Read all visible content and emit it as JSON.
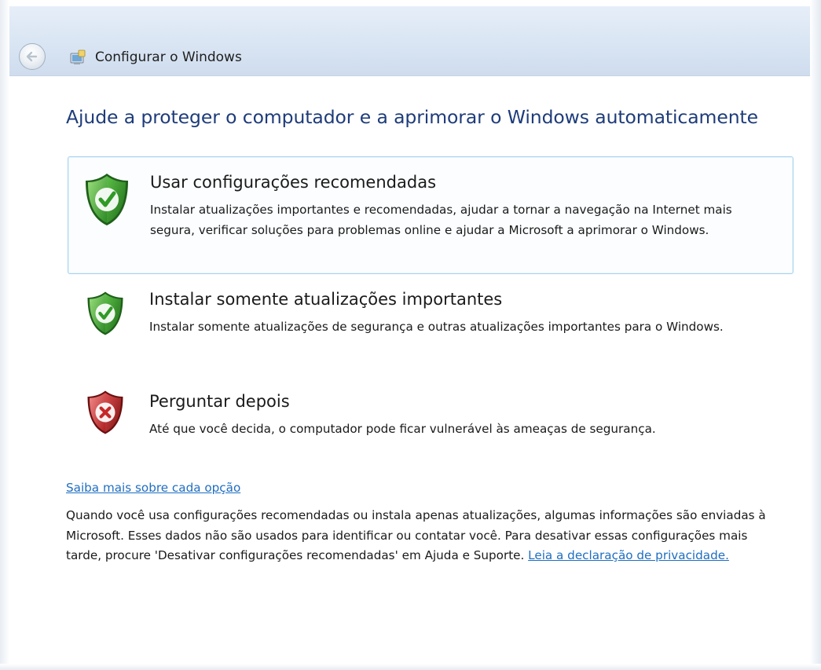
{
  "window": {
    "title": "Configurar o Windows"
  },
  "page": {
    "heading": "Ajude a proteger o computador e a aprimorar o Windows automaticamente"
  },
  "options": [
    {
      "title": "Usar configurações recomendadas",
      "description": "Instalar atualizações importantes e recomendadas, ajudar a tornar a navegação na Internet mais segura, verificar soluções para problemas online e ajudar a Microsoft a aprimorar o Windows.",
      "icon": "shield-check-icon",
      "selected": true
    },
    {
      "title": "Instalar somente atualizações importantes",
      "description": "Instalar somente atualizações de segurança e outras atualizações importantes para o Windows.",
      "icon": "shield-check-icon",
      "selected": false
    },
    {
      "title": "Perguntar depois",
      "description": "Até que você decida, o computador pode ficar vulnerável às ameaças de segurança.",
      "icon": "shield-x-icon",
      "selected": false
    }
  ],
  "learn_more_link": "Saiba mais sobre cada opção",
  "info": {
    "text": "Quando você usa configurações recomendadas ou instala apenas atualizações, algumas informações são enviadas à Microsoft. Esses dados não são usados para identificar ou contatar você. Para desativar essas configurações mais tarde, procure 'Desativar configurações recomendadas' em Ajuda e Suporte.",
    "privacy_link": "Leia a declaração de privacidade."
  },
  "colors": {
    "heading": "#1e3c7a",
    "link": "#1f6ec1",
    "selected_border": "#a8d3ee",
    "shield_green": "#2e9a2e",
    "shield_red": "#c62828"
  }
}
